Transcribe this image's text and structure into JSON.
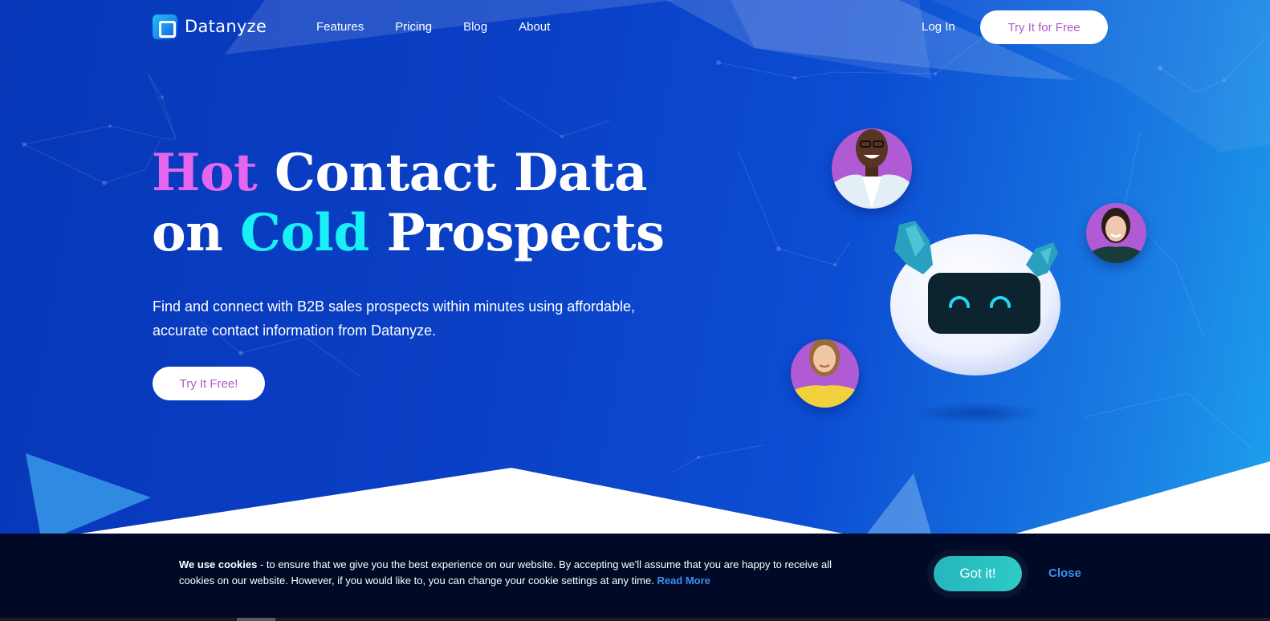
{
  "header": {
    "logo_text": "Datanyze",
    "nav": [
      {
        "label": "Features"
      },
      {
        "label": "Pricing"
      },
      {
        "label": "Blog"
      },
      {
        "label": "About"
      }
    ],
    "login_label": "Log In",
    "cta_label": "Try It for Free"
  },
  "hero": {
    "headline": {
      "word_hot": "Hot",
      "rest_line1": " Contact Data",
      "word_on": "on ",
      "word_cold": "Cold",
      "rest_line2": " Prospects"
    },
    "subtitle": "Find and connect with B2B sales prospects within minutes using affordable, accurate contact information from Datanyze.",
    "cta_label": "Try It Free!",
    "illustration": {
      "robot": "robot-mascot",
      "avatars": [
        "man-with-glasses",
        "woman-dark-hair",
        "woman-blonde"
      ]
    }
  },
  "cookie_banner": {
    "bold_lead": "We use cookies",
    "text": " -  to ensure that we give you the best experience on our website. By accepting we'll assume that you are happy to receive all cookies on our website. However, if you would like to, you can change your cookie settings at any time.  ",
    "read_more_label": "Read More",
    "accept_label": "Got it!",
    "close_label": "Close"
  },
  "colors": {
    "hot_accent": "#e565ee",
    "cold_accent": "#18f0f6",
    "cta_text": "#b259c9",
    "accept_button": "#2ccbc5",
    "link_blue": "#3a8ef0",
    "cookie_bg": "#000a26"
  }
}
